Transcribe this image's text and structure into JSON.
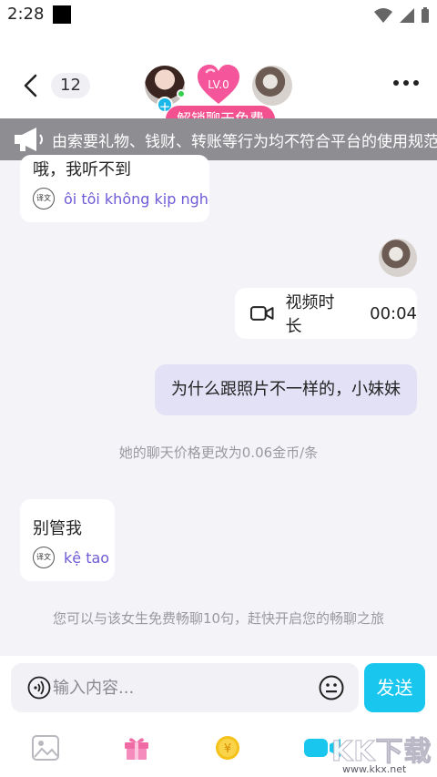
{
  "status_bar": {
    "time": "2:28"
  },
  "header": {
    "count_badge": "12",
    "level": "LV.0",
    "unlock_label": "解锁聊天免费"
  },
  "notice": {
    "text": "由索要礼物、钱财、转账等行为均不符合平台的使用规范，请"
  },
  "messages": {
    "received_1": {
      "text": "哦，我听不到",
      "translation": "ôi tôi không kịp nghe",
      "translate_badge": "译文"
    },
    "video_call": {
      "label": "视频时长",
      "duration": "00:04"
    },
    "sent_1": {
      "text": "为什么跟照片不一样的，小妹妹"
    },
    "system_price": "她的聊天价格更改为0.06金币/条",
    "received_2": {
      "text": "别管我",
      "translation": "kệ tao",
      "translate_badge": "译文"
    },
    "system_free": "您可以与该女生免费畅聊10句，赶快开启您的畅聊之旅"
  },
  "input": {
    "placeholder": "输入内容...",
    "send_label": "发送"
  },
  "watermark": {
    "brand": "KK下载",
    "url": "www.kkx.net"
  },
  "colors": {
    "accent": "#18c6ee",
    "pink": "#f2508e",
    "translation": "#6e5ad6",
    "sent_bubble": "#e3e1f6"
  },
  "icons": [
    "back-arrow-icon",
    "more-dots-icon",
    "megaphone-icon",
    "translate-icon",
    "video-camera-icon",
    "voice-icon",
    "emoji-icon",
    "image-icon",
    "gift-icon",
    "coin-icon",
    "video-call-icon"
  ]
}
